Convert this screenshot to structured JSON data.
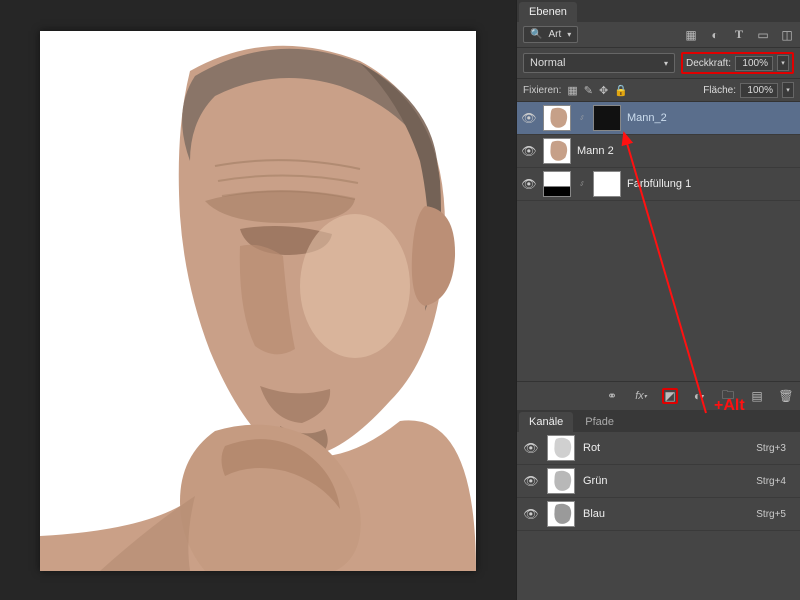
{
  "panels": {
    "layers_tab": "Ebenen",
    "channels_tab": "Kanäle",
    "paths_tab": "Pfade"
  },
  "filter": {
    "kind_label": "Art"
  },
  "blend": {
    "mode": "Normal",
    "opacity_label": "Deckkraft:",
    "opacity_value": "100%"
  },
  "lock": {
    "label": "Fixieren:",
    "fill_label": "Fläche:",
    "fill_value": "100%"
  },
  "layers": [
    {
      "name": "Mann_2",
      "selected": true,
      "has_mask": true
    },
    {
      "name": "Mann 2",
      "selected": false,
      "has_mask": false
    },
    {
      "name": "Farbfüllung 1",
      "selected": false,
      "has_mask": true
    }
  ],
  "channels": [
    {
      "name": "Rot",
      "shortcut": "Strg+3"
    },
    {
      "name": "Grün",
      "shortcut": "Strg+4"
    },
    {
      "name": "Blau",
      "shortcut": "Strg+5"
    }
  ],
  "annotation": {
    "alt_label": "+Alt"
  }
}
